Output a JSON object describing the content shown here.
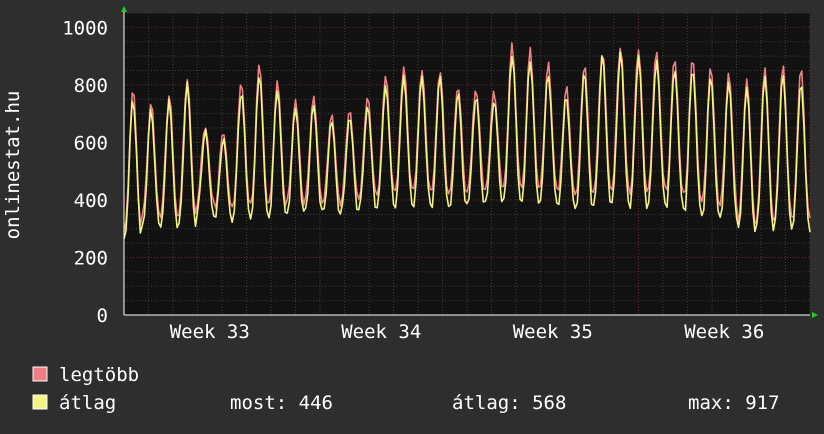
{
  "chart_data": {
    "type": "line",
    "ylabel": "onlinestat.hu",
    "xlabel": "",
    "title": "",
    "ylim": [
      0,
      1050
    ],
    "y_ticks": [
      0,
      200,
      400,
      600,
      800,
      1000
    ],
    "x_ticks": [
      {
        "label": "Week 33",
        "pos": 0.125
      },
      {
        "label": "Week 34",
        "pos": 0.375
      },
      {
        "label": "Week 35",
        "pos": 0.625
      },
      {
        "label": "Week 36",
        "pos": 0.875
      }
    ],
    "grid": true,
    "background": "#121212",
    "grid_color": "#5a2a2a",
    "series": [
      {
        "name": "legtöbb",
        "color": "#f27f86",
        "peaks": [
          780,
          735,
          765,
          825,
          660,
          640,
          810,
          870,
          810,
          745,
          760,
          700,
          715,
          760,
          830,
          860,
          850,
          850,
          800,
          790,
          780,
          940,
          920,
          870,
          790,
          870,
          920,
          940,
          930,
          920,
          890,
          890,
          860,
          840,
          820,
          860,
          870,
          860
        ],
        "troughs": [
          290,
          350,
          340,
          350,
          390,
          370,
          380,
          380,
          380,
          390,
          400,
          390,
          400,
          410,
          420,
          430,
          430,
          420,
          420,
          430,
          440,
          450,
          440,
          440,
          420,
          410,
          430,
          440,
          420,
          440,
          420,
          400,
          390,
          380,
          320,
          330,
          340,
          330
        ]
      },
      {
        "name": "átlag",
        "color": "#f4f483",
        "peaks": [
          750,
          710,
          740,
          800,
          640,
          615,
          780,
          840,
          785,
          720,
          730,
          675,
          690,
          730,
          800,
          830,
          825,
          825,
          770,
          760,
          750,
          910,
          890,
          840,
          760,
          840,
          900,
          910,
          900,
          890,
          860,
          860,
          830,
          810,
          790,
          830,
          840,
          810
        ],
        "troughs": [
          265,
          310,
          300,
          310,
          350,
          330,
          340,
          340,
          340,
          350,
          360,
          350,
          360,
          370,
          380,
          380,
          380,
          370,
          370,
          380,
          390,
          400,
          390,
          390,
          370,
          360,
          380,
          390,
          370,
          390,
          370,
          350,
          340,
          330,
          290,
          300,
          310,
          300
        ]
      }
    ],
    "stats": {
      "now": 446,
      "avg": 568,
      "max": 917
    }
  },
  "legend": {
    "items": [
      {
        "label": "legtöbb",
        "color": "#f27f86"
      },
      {
        "label": "átlag",
        "color": "#f4f483"
      }
    ],
    "now_label": "most: 446",
    "avg_label": "átlag: 568",
    "max_label": "max: 917"
  }
}
